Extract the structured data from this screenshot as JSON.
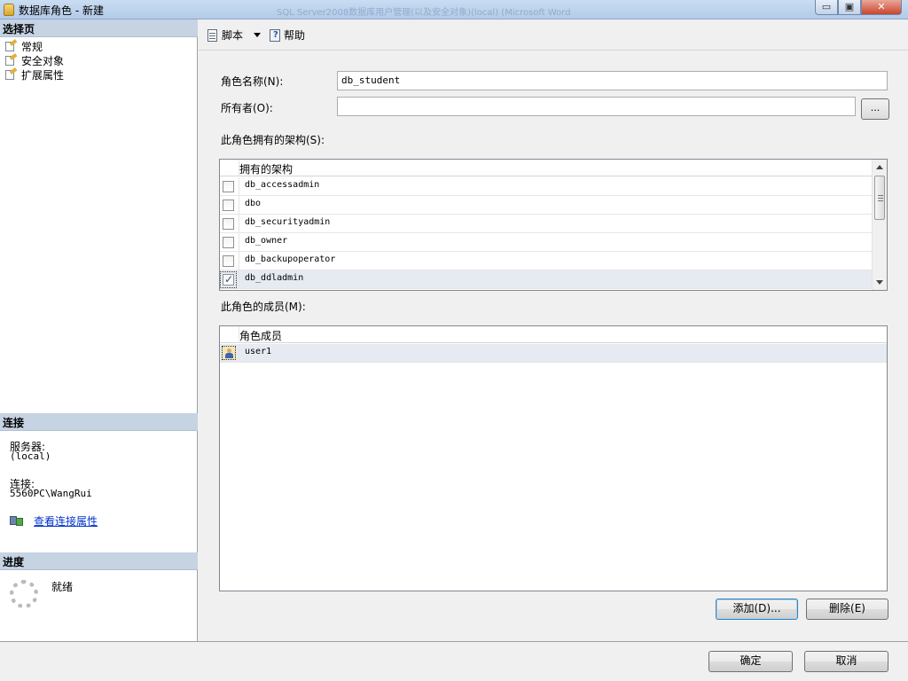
{
  "window": {
    "title": "数据库角色 - 新建",
    "background_title": "SQL Server2008数据库用户管理(以及安全对象)(local) (Microsoft Word",
    "controls": {
      "minimize": "▭",
      "maximize": "▣",
      "close": "✕"
    }
  },
  "left_panel": {
    "select_page": {
      "header": "选择页",
      "items": [
        {
          "label": "常规",
          "icon": "page-icon"
        },
        {
          "label": "安全对象",
          "icon": "page-icon"
        },
        {
          "label": "扩展属性",
          "icon": "page-icon"
        }
      ]
    },
    "connection": {
      "header": "连接",
      "server_label": "服务器:",
      "server_value": "(local)",
      "connection_label": "连接:",
      "connection_value": "5560PC\\WangRui",
      "view_properties_link": "查看连接属性"
    },
    "progress": {
      "header": "进度",
      "status": "就绪"
    }
  },
  "toolbar": {
    "script_label": "脚本",
    "help_label": "帮助"
  },
  "form": {
    "role_name_label": "角色名称(N):",
    "role_name_value": "db_student",
    "owner_label": "所有者(O):",
    "owner_value": "",
    "browse_label": "...",
    "schemas_label": "此角色拥有的架构(S):",
    "schemas_grid": {
      "column_header": "拥有的架构",
      "rows": [
        {
          "name": "db_accessadmin",
          "checked": false
        },
        {
          "name": "dbo",
          "checked": false
        },
        {
          "name": "db_securityadmin",
          "checked": false
        },
        {
          "name": "db_owner",
          "checked": false
        },
        {
          "name": "db_backupoperator",
          "checked": false
        },
        {
          "name": "db_ddladmin",
          "checked": true
        }
      ]
    },
    "members_label": "此角色的成员(M):",
    "members_grid": {
      "column_header": "角色成员",
      "rows": [
        {
          "name": "user1",
          "icon": "user-icon"
        }
      ]
    },
    "add_button": "添加(D)...",
    "remove_button": "删除(E)"
  },
  "footer": {
    "ok_button": "确定",
    "cancel_button": "取消"
  },
  "colors": {
    "section_header": "#c6d3e3",
    "link": "#0033cc",
    "selected_row": "#e6eaf1"
  }
}
